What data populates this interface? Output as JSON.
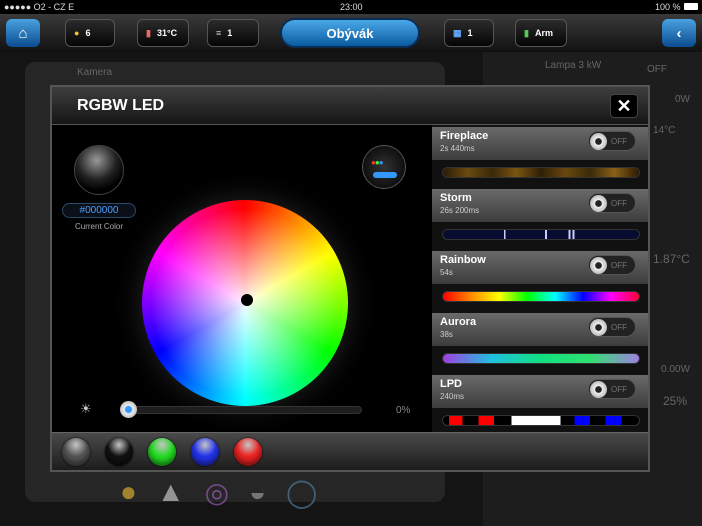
{
  "status": {
    "carrier": "●●●●● O2 - CZ   E",
    "time": "23:00",
    "battery": "100 %"
  },
  "toolbar": {
    "lights": "6",
    "temperature": "31°C",
    "blinds": "1",
    "room": "Obývák",
    "windows": "1",
    "alarm": "Arm"
  },
  "background": {
    "camera": "Kamera",
    "lamp": "Lampa 3 kW",
    "power1": "0W",
    "temp1": "14°C",
    "temp2": "1.87°C",
    "power2": "0.00W",
    "percent": "25%",
    "off": "OFF"
  },
  "modal": {
    "title": "RGBW LED",
    "current_color": {
      "value": "#000000",
      "label": "Current Color"
    },
    "brightness": {
      "value": "0%",
      "level": 0
    },
    "effects": [
      {
        "name": "Fireplace",
        "duration": "2s 440ms",
        "state": "OFF"
      },
      {
        "name": "Storm",
        "duration": "26s 200ms",
        "state": "OFF"
      },
      {
        "name": "Rainbow",
        "duration": "54s",
        "state": "OFF"
      },
      {
        "name": "Aurora",
        "duration": "38s",
        "state": "OFF"
      },
      {
        "name": "LPD",
        "duration": "240ms",
        "state": "OFF"
      }
    ],
    "swatches": [
      "#555555",
      "#111111",
      "#22dd22",
      "#2233ee",
      "#ee2222"
    ]
  }
}
